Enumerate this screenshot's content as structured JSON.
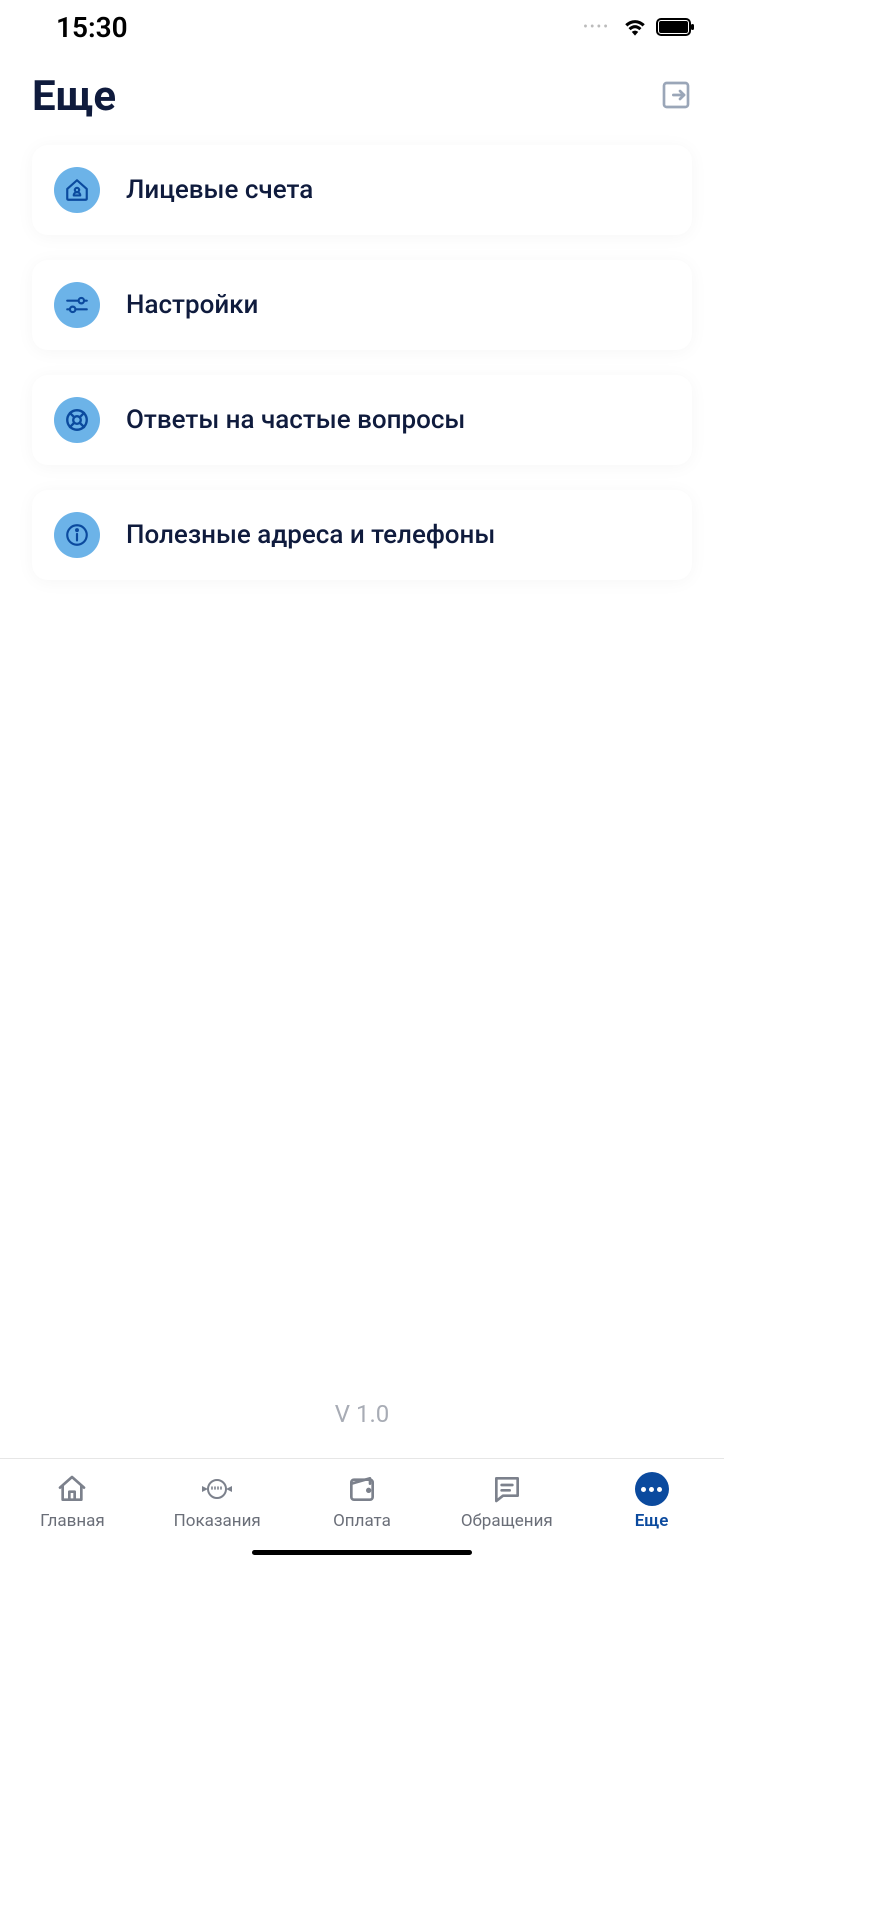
{
  "status": {
    "time": "15:30"
  },
  "header": {
    "title": "Еще"
  },
  "menu": {
    "items": [
      {
        "label": "Лицевые счета",
        "icon": "house-icon"
      },
      {
        "label": "Настройки",
        "icon": "sliders-icon"
      },
      {
        "label": "Ответы на частые вопросы",
        "icon": "lifebuoy-icon"
      },
      {
        "label": "Полезные адреса и телефоны",
        "icon": "info-icon"
      }
    ]
  },
  "version": "V 1.0",
  "tabs": {
    "items": [
      {
        "label": "Главная"
      },
      {
        "label": "Показания"
      },
      {
        "label": "Оплата"
      },
      {
        "label": "Обращения"
      },
      {
        "label": "Еще"
      }
    ]
  }
}
